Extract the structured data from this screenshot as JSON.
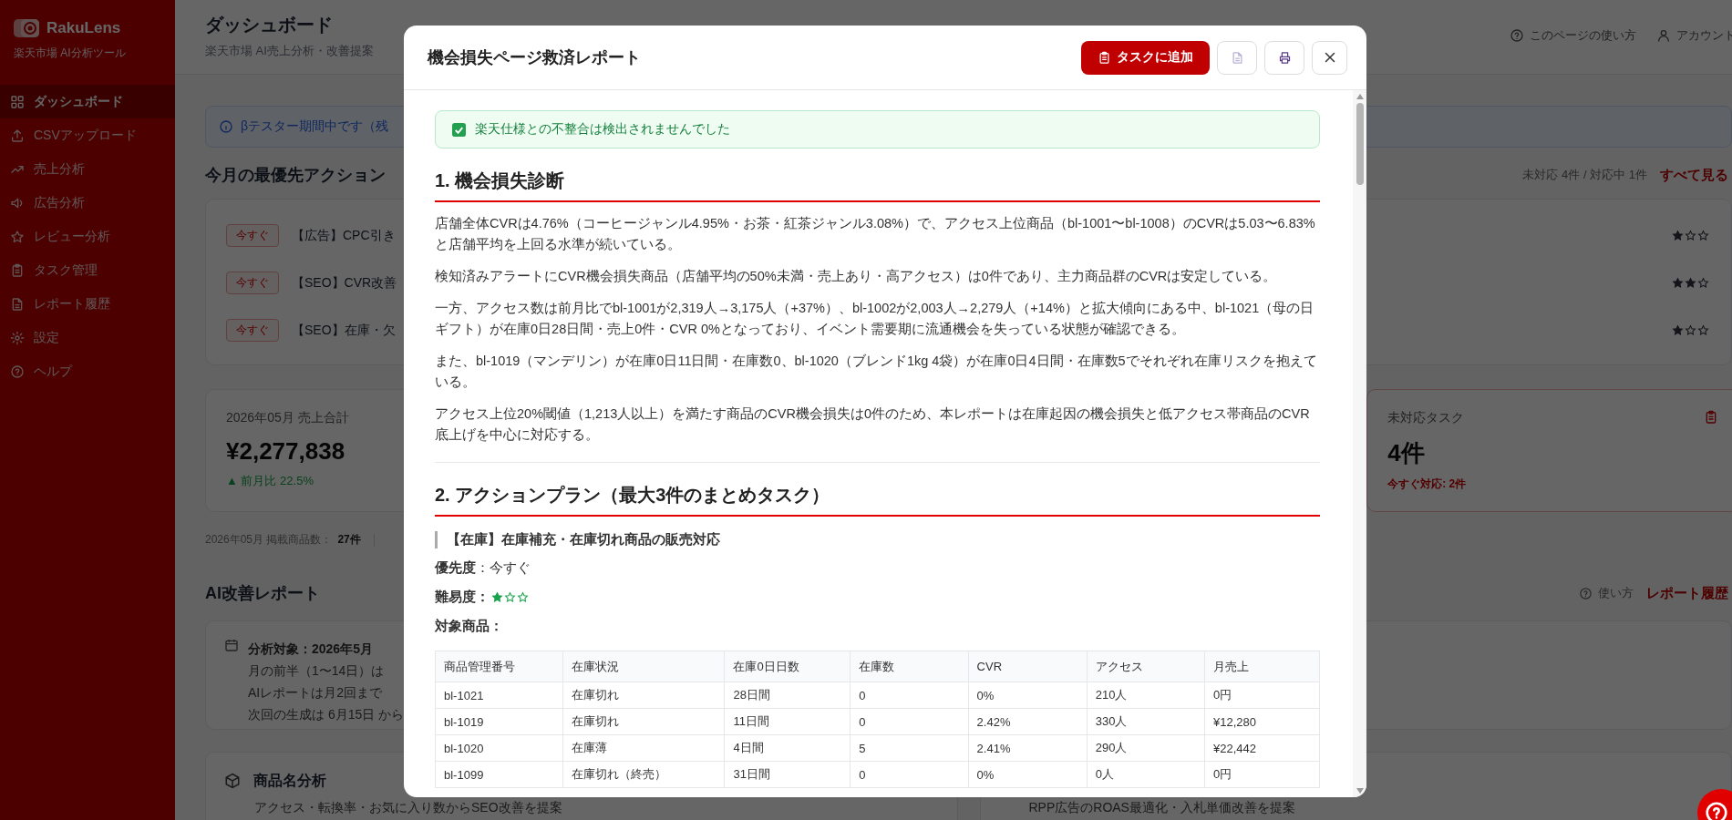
{
  "sidebar": {
    "logo": "RakuLens",
    "tagline": "楽天市場 AI分析ツール",
    "items": [
      {
        "label": "ダッシュボード",
        "selected": true
      },
      {
        "label": "CSVアップロード",
        "selected": false
      },
      {
        "label": "売上分析",
        "selected": false
      },
      {
        "label": "広告分析",
        "selected": false
      },
      {
        "label": "レビュー分析",
        "selected": false
      },
      {
        "label": "タスク管理",
        "selected": false
      },
      {
        "label": "レポート履歴",
        "selected": false
      },
      {
        "label": "設定",
        "selected": false
      },
      {
        "label": "ヘルプ",
        "selected": false
      }
    ]
  },
  "header": {
    "title": "ダッシュボード",
    "subtitle": "楽天市場 AI売上分析・改善提案",
    "links": [
      {
        "label": "このページの使い方"
      },
      {
        "label": "アカウント"
      }
    ]
  },
  "notice": {
    "text": "βテスター期間中です（残"
  },
  "priority": {
    "title": "今月の最優先アクション",
    "summary": "未対応 4件 / 対応中 1件",
    "link": "すべて見る",
    "actions": [
      {
        "badge": "今すぐ",
        "text": "【広告】CPC引き",
        "stars": 1
      },
      {
        "badge": "今すぐ",
        "text": "【SEO】CVR改善",
        "stars": 2
      },
      {
        "badge": "今すぐ",
        "text": "【SEO】在庫・欠",
        "stars": 1
      }
    ]
  },
  "stats": [
    {
      "kind": "sales",
      "label": "2026年05月 売上合計",
      "value": "¥2,277,838",
      "delta": "▲ 前月比 22.5%"
    },
    {
      "kind": "tasks",
      "label": "未対応タスク",
      "value": "4件",
      "note": "今すぐ対応: 2件"
    }
  ],
  "listing": {
    "label": "2026年05月 掲載商品数：",
    "value": "27件"
  },
  "ai_report": {
    "title": "AI改善レポート",
    "help": "使い方",
    "link": "レポート履歴",
    "info_lines": [
      "分析対象：2026年5月",
      "月の前半（1〜14日）は",
      "AIレポートは月2回まで",
      "次回の生成は 6月15日 から"
    ]
  },
  "feature_cards": [
    {
      "title": "商品名分析",
      "description": "アクセス・転換率・お気に入り数からSEO改善を提案"
    },
    {
      "description": "RPP広告のROAS最適化・入札単価改善を提案"
    }
  ],
  "modal": {
    "title": "機会損失ページ救済レポート",
    "actions": [
      {
        "kind": "primary",
        "label": "タスクに追加"
      },
      {
        "kind": "document"
      },
      {
        "kind": "print"
      },
      {
        "kind": "close"
      }
    ],
    "alert": {
      "text": "楽天仕様との不整合は検出されませんでした"
    },
    "sections": [
      {
        "heading": "1. 機会損失診断",
        "paragraphs": [
          "店舗全体CVRは4.76%（コーヒージャンル4.95%・お茶・紅茶ジャンル3.08%）で、アクセス上位商品（bl-1001〜bl-1008）のCVRは5.03〜6.83%と店舗平均を上回る水準が続いている。",
          "検知済みアラートにCVR機会損失商品（店舗平均の50%未満・売上あり・高アクセス）は0件であり、主力商品群のCVRは安定している。",
          "一方、アクセス数は前月比でbl-1001が2,319人→3,175人（+37%）、bl-1002が2,003人→2,279人（+14%）と拡大傾向にある中、bl-1021（母の日ギフト）が在庫0日28日間・売上0件・CVR 0%となっており、イベント需要期に流通機会を失っている状態が確認できる。",
          "また、bl-1019（マンデリン）が在庫0日11日間・在庫数0、bl-1020（ブレンド1kg 4袋）が在庫0日4日間・在庫数5でそれぞれ在庫リスクを抱えている。",
          "アクセス上位20%閾値（1,213人以上）を満たす商品のCVR機会損失は0件のため、本レポートは在庫起因の機会損失と低アクセス帯商品のCVR底上げを中心に対応する。"
        ]
      },
      {
        "heading": "2. アクションプラン（最大3件のまとめタスク）",
        "tasks": [
          {
            "title": "【在庫】在庫補充・在庫切れ商品の販売対応",
            "fields": [
              {
                "kind": "text",
                "text": "**優先度**：今すぐ"
              },
              {
                "kind": "stars",
                "label": "難易度：",
                "stars": 1
              },
              {
                "kind": "heading",
                "label": "対象商品："
              }
            ],
            "table": {
              "columns": [
                "商品管理番号",
                "在庫状況",
                "在庫0日日数",
                "在庫数",
                "CVR",
                "アクセス",
                "月売上"
              ],
              "rows": [
                [
                  "bl-1021",
                  "在庫切れ",
                  "28日間",
                  "0",
                  "0%",
                  "210人",
                  "0円"
                ],
                [
                  "bl-1019",
                  "在庫切れ",
                  "11日間",
                  "0",
                  "2.42%",
                  "330人",
                  "¥12,280"
                ],
                [
                  "bl-1020",
                  "在庫薄",
                  "4日間",
                  "5",
                  "2.41%",
                  "290人",
                  "¥22,442"
                ],
                [
                  "bl-1099",
                  "在庫切れ（終売）",
                  "31日間",
                  "0",
                  "0%",
                  "0人",
                  "0円"
                ]
              ]
            }
          }
        ]
      }
    ]
  }
}
